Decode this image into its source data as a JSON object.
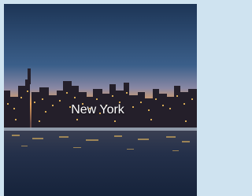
{
  "city_card": {
    "city_name": "New York",
    "image_subject": "city-skyline-at-dusk",
    "colors": {
      "sky_top": "#1d3556",
      "sky_mid": "#3b5f8a",
      "horizon": "#e7a25a",
      "water": "#1e2c45",
      "lights": "#f6c35e",
      "border": "#cfe3f0"
    }
  }
}
